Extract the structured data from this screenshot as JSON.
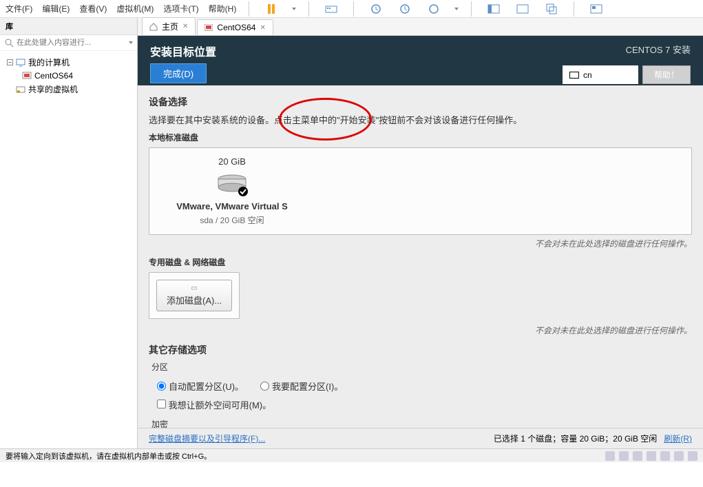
{
  "menu": {
    "file": "文件(F)",
    "edit": "编辑(E)",
    "view": "查看(V)",
    "vm": "虚拟机(M)",
    "tabs": "选项卡(T)",
    "help": "帮助(H)"
  },
  "sidebar": {
    "title": "库",
    "searchPlaceholder": "在此处键入内容进行...",
    "myComputer": "我的计算机",
    "vm1": "CentOS64",
    "shared": "共享的虚拟机"
  },
  "tabs": {
    "home": "主页",
    "vm": "CentOS64"
  },
  "installer": {
    "headerTitle": "安装目标位置",
    "doneBtn": "完成(D)",
    "osTitle": "CENTOS 7 安装",
    "lang": "cn",
    "helpBtn": "帮助！",
    "deviceSelect": "设备选择",
    "deviceDesc": "选择要在其中安装系统的设备。点击主菜单中的\"开始安装\"按钮前不会对该设备进行任何操作。",
    "localStd": "本地标准磁盘",
    "diskSize": "20 GiB",
    "diskName": "VMware, VMware Virtual S",
    "diskInfo": "sda    /    20 GiB 空闲",
    "diskNote": "不会对未在此处选择的磁盘进行任何操作。",
    "specNet": "专用磁盘 & 网络磁盘",
    "addDisk": "添加磁盘(A)...",
    "otherStorage": "其它存储选项",
    "partition": "分区",
    "autoPart": "自动配置分区(U)。",
    "manualPart": "我要配置分区(I)。",
    "extraSpace": "我想让额外空间可用(M)。",
    "encrypt": "加密",
    "summary": "完整磁盘摘要以及引导程序(F)...",
    "selected": "已选择 1 个磁盘；容量 20 GiB；20 GiB 空闲",
    "refresh": "刷新(R)"
  },
  "status": {
    "hint": "要将输入定向到该虚拟机，请在虚拟机内部单击或按 Ctrl+G。"
  }
}
